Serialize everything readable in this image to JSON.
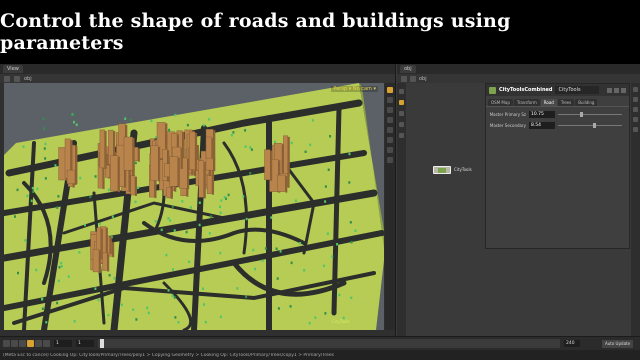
{
  "banner": {
    "title": "Control the shape of roads and buildings using parameters"
  },
  "viewer": {
    "tab_label": "View",
    "path": "obj",
    "view_label": "Persp ▾  No cam ▾",
    "bbox_label": "CityTools"
  },
  "network": {
    "path": "obj",
    "node_name": "CityTools"
  },
  "params": {
    "node_type": "CityToolsCombined",
    "node_name": "CityTools",
    "tabs": [
      "OSM Map",
      "Transform",
      "Road",
      "Trees",
      "Building"
    ],
    "active_tab": 2,
    "rows": [
      {
        "label": "Master Primary Sz",
        "value": "10.75",
        "fraction": 0.35
      },
      {
        "label": "Master Secondary",
        "value": "8.54",
        "fraction": 0.55
      }
    ]
  },
  "timeline": {
    "frame": "1",
    "start": "1",
    "end": "240"
  },
  "auto_update": "Auto Update",
  "status": "(Meta Esc to cancel) Cooking Op: CityTools/Primary/Trees/poly1 > Copying Geometry > Cooking Op: CityTools/Primary/Trees/copy1 > Primary/Trees",
  "colors": {
    "ground": "#b6cc55",
    "road": "#2b2e2b",
    "building": "#b8844c",
    "tree": "#4ec76a",
    "accent": "#d8a330"
  }
}
